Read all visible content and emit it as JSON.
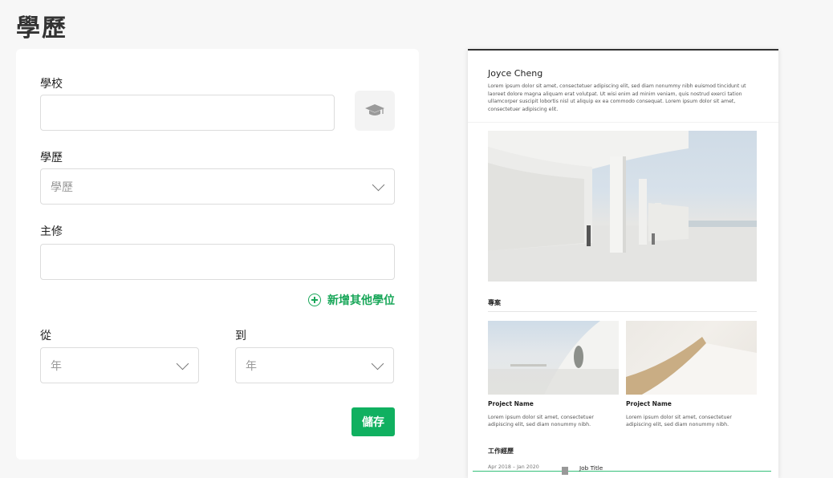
{
  "page": {
    "title": "學歷"
  },
  "form": {
    "school_label": "學校",
    "school_value": "",
    "school_icon": "graduation-cap-icon",
    "degree_label": "學歷",
    "degree_placeholder": "學歷",
    "major_label": "主修",
    "major_value": "",
    "add_degree_label": "新增其他學位",
    "from_label": "從",
    "to_label": "到",
    "from_year_placeholder": "年",
    "to_year_placeholder": "年",
    "save_label": "儲存"
  },
  "preview": {
    "name": "Joyce Cheng",
    "bio": "Lorem ipsum dolor sit amet, consectetuer adipiscing elit, sed diam nonummy nibh euismod tincidunt ut laoreet dolore magna aliquam erat volutpat. Ut wisi enim ad minim veniam, quis nostrud exerci tation ullamcorper suscipit lobortis nisl ut aliquip ex ea commodo consequat. Lorem ipsum dolor sit amet, consectetuer adipiscing elit.",
    "projects_heading": "專案",
    "projects": [
      {
        "name": "Project Name",
        "desc": "Lorem ipsum dolor sit amet, consectetuer adipiscing elit, sed diam nonummy nibh."
      },
      {
        "name": "Project Name",
        "desc": "Lorem ipsum dolor sit amet, consectetuer adipiscing elit, sed diam nonummy nibh."
      }
    ],
    "experience_heading": "工作經歷",
    "experience": [
      {
        "date": "Apr 2018 – Jan 2020",
        "title": "Job Title"
      }
    ]
  },
  "colors": {
    "accent": "#10b060",
    "accent_text": "#1aa75a"
  }
}
